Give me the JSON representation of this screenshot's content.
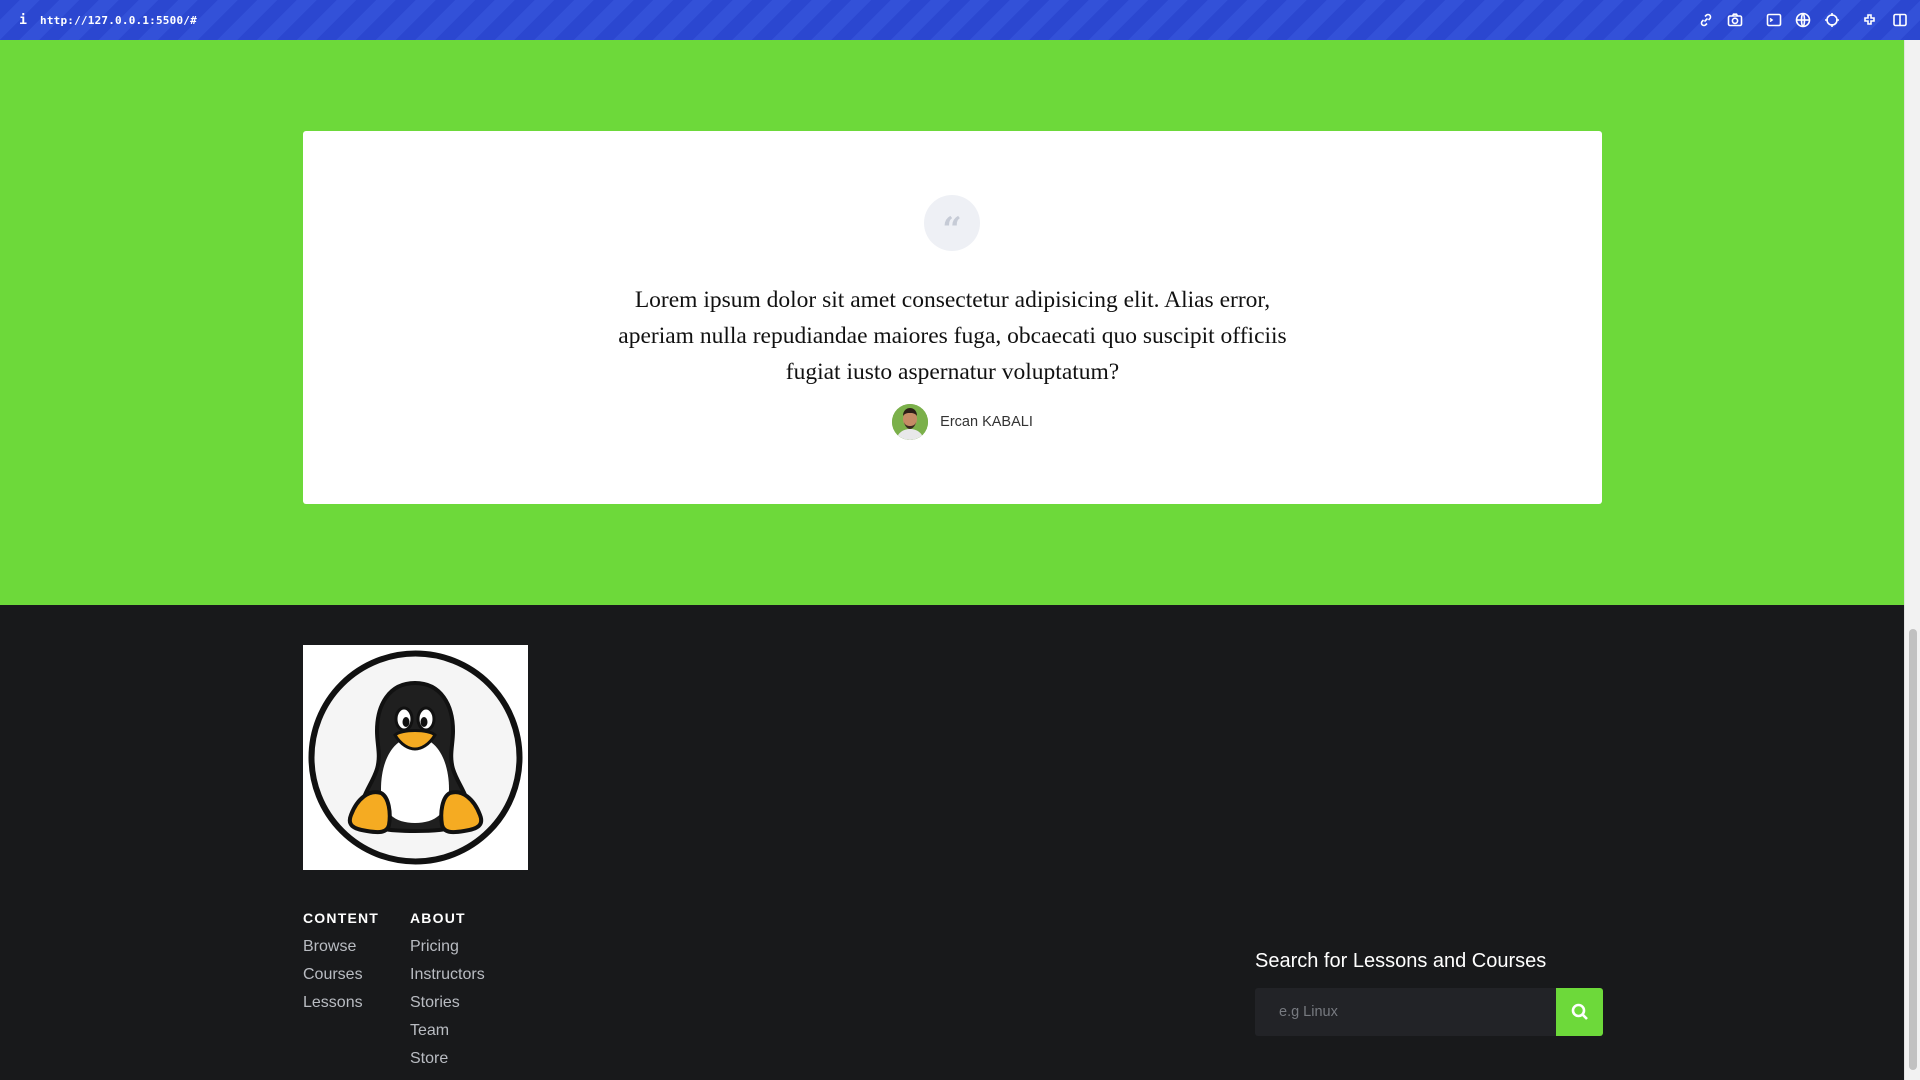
{
  "browser": {
    "info": "i",
    "url": "http://127.0.0.1:5500/#",
    "icons": [
      "link-icon",
      "camera-icon",
      "terminal-icon",
      "globe-icon",
      "crosshair-icon",
      "extension-icon",
      "sidebar-icon"
    ]
  },
  "testimonial": {
    "quote_glyph": "“",
    "quote": "Lorem ipsum dolor sit amet consectetur adipisicing elit. Alias error, aperiam nulla repudiandae maiores fuga, obcaecati quo suscipit officiis fugiat iusto aspernatur voluptatum?",
    "author": "Ercan KABALI"
  },
  "footer": {
    "content_title": "CONTENT",
    "content_links": [
      "Browse",
      "Courses",
      "Lessons"
    ],
    "about_title": "ABOUT",
    "about_links": [
      "Pricing",
      "Instructors",
      "Stories",
      "Team",
      "Store"
    ],
    "search_title": "Search for Lessons and Courses",
    "search_placeholder": "e.g Linux"
  },
  "colors": {
    "accent_green": "#6dd93a",
    "footer_bg": "#18191b",
    "browser_bar": "#2b47d0"
  }
}
